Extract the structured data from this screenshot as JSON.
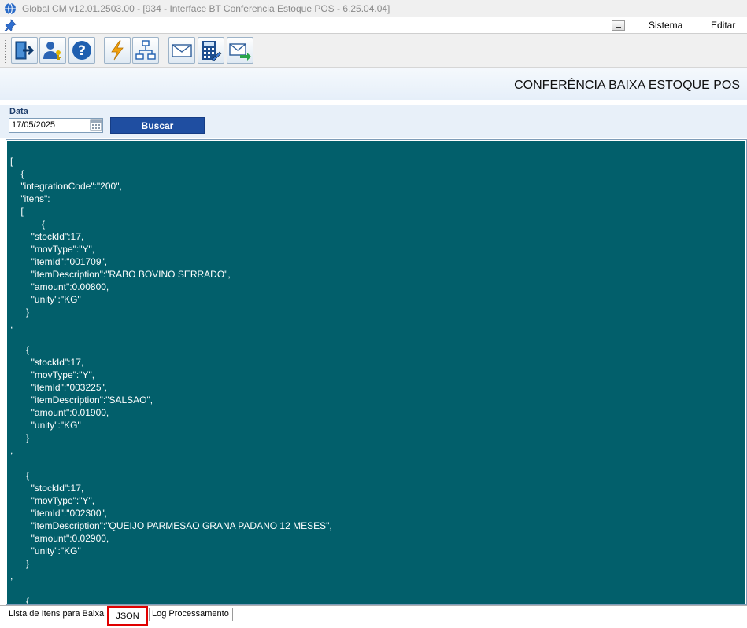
{
  "window": {
    "title": "Global CM v12.01.2503.00 - [934 - Interface BT Conferencia Estoque POS - 6.25.04.04]"
  },
  "menu": {
    "items": [
      "Sistema",
      "Editar"
    ]
  },
  "toolbar": {
    "buttons": [
      {
        "icon": "exit-icon"
      },
      {
        "icon": "user-key-icon"
      },
      {
        "icon": "help-icon"
      },
      {
        "icon": "lightning-icon"
      },
      {
        "icon": "org-chart-icon"
      },
      {
        "icon": "mail-icon"
      },
      {
        "icon": "calculator-edit-icon"
      },
      {
        "icon": "mail-send-icon"
      }
    ]
  },
  "header": {
    "title": "CONFERÊNCIA BAIXA ESTOQUE POS"
  },
  "filter": {
    "date_label": "Data",
    "date_value": "17/05/2025",
    "search_label": "Buscar"
  },
  "json_view": {
    "lines": [
      "[",
      "    {",
      "    \"integrationCode\":\"200\",",
      "    \"itens\":",
      "    [",
      "            {",
      "        \"stockId\":17,",
      "        \"movType\":\"Y\",",
      "        \"itemId\":\"001709\",",
      "        \"itemDescription\":\"RABO BOVINO SERRADO\",",
      "        \"amount\":0.00800,",
      "        \"unity\":\"KG\"",
      "      }",
      ",",
      "",
      "      {",
      "        \"stockId\":17,",
      "        \"movType\":\"Y\",",
      "        \"itemId\":\"003225\",",
      "        \"itemDescription\":\"SALSAO\",",
      "        \"amount\":0.01900,",
      "        \"unity\":\"KG\"",
      "      }",
      ",",
      "",
      "      {",
      "        \"stockId\":17,",
      "        \"movType\":\"Y\",",
      "        \"itemId\":\"002300\",",
      "        \"itemDescription\":\"QUEIJO PARMESAO GRANA PADANO 12 MESES\",",
      "        \"amount\":0.02900,",
      "        \"unity\":\"KG\"",
      "      }",
      ",",
      "",
      "      {"
    ]
  },
  "tabs": {
    "items": [
      "Lista de Itens para Baixa",
      "JSON",
      "Log Processamento"
    ],
    "active": "JSON"
  },
  "colors": {
    "json_background": "#025f6b",
    "button_blue": "#1f4ea1",
    "highlight_red": "#e00000"
  }
}
